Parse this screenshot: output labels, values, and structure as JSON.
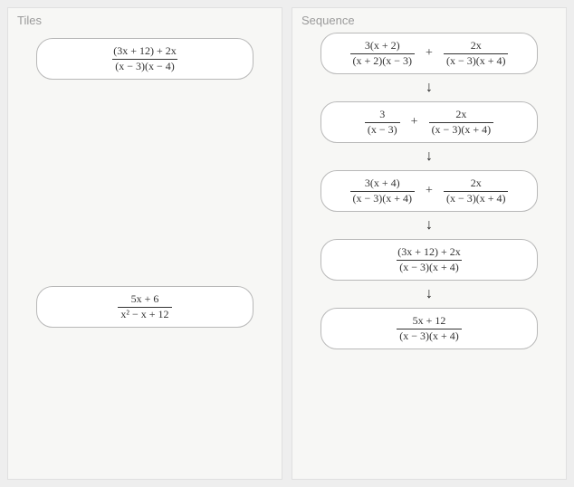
{
  "panels": {
    "tiles_title": "Tiles",
    "sequence_title": "Sequence"
  },
  "tiles": {
    "t1": {
      "num": "(3x + 12) + 2x",
      "den": "(x − 3)(x − 4)"
    },
    "t2": {
      "num": "5x + 6",
      "den": "x² − x + 12"
    }
  },
  "arrow": "↓",
  "plus": "+",
  "sequence": {
    "s1": {
      "left": {
        "num": "3(x + 2)",
        "den": "(x + 2)(x − 3)"
      },
      "right": {
        "num": "2x",
        "den": "(x − 3)(x + 4)"
      }
    },
    "s2": {
      "left": {
        "num": "3",
        "den": "(x − 3)"
      },
      "right": {
        "num": "2x",
        "den": "(x − 3)(x + 4)"
      }
    },
    "s3": {
      "left": {
        "num": "3(x + 4)",
        "den": "(x − 3)(x + 4)"
      },
      "right": {
        "num": "2x",
        "den": "(x − 3)(x + 4)"
      }
    },
    "s4": {
      "num": "(3x + 12) + 2x",
      "den": "(x − 3)(x + 4)"
    },
    "s5": {
      "num": "5x + 12",
      "den": "(x − 3)(x + 4)"
    }
  }
}
